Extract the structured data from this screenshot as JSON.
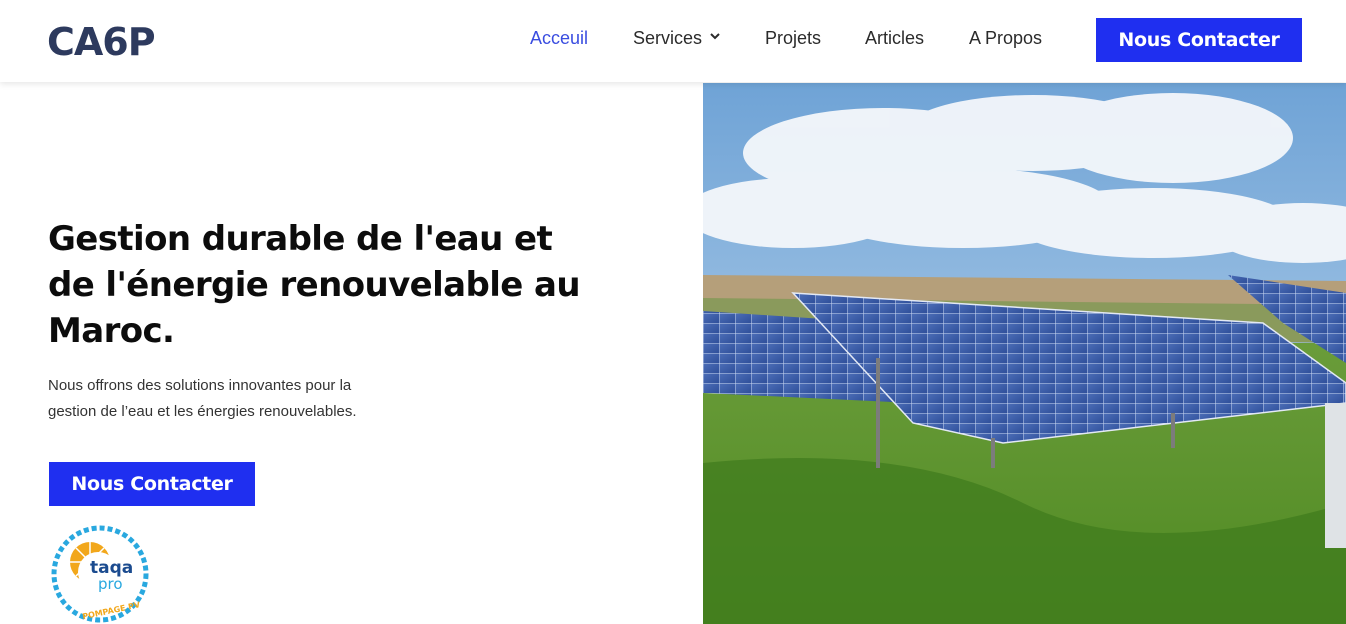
{
  "header": {
    "logo_text": "CA6P",
    "nav": [
      {
        "label": "Acceuil"
      },
      {
        "label": "Services"
      },
      {
        "label": "Projets"
      },
      {
        "label": "Articles"
      },
      {
        "label": "A Propos"
      }
    ],
    "cta_label": "Nous Contacter"
  },
  "hero": {
    "title_line1": "Gestion durable de l'eau et",
    "title_line2": "de l'énergie renouvelable au",
    "title_line3": "Maroc.",
    "subtitle_line1": "Nous offrons des solutions innovantes pour la",
    "subtitle_line2": "gestion de l’eau et les énergies renouvelables.",
    "cta_label": "Nous Contacter",
    "badge": {
      "brand_line1": "taqa",
      "brand_line2": "pro",
      "caption": "POMPAGE PV"
    }
  },
  "colors": {
    "accent": "#1f2ff0",
    "nav_active": "#3a4de0",
    "logo": "#2d3a5e"
  },
  "icons": {
    "services_dropdown": "chevron-down-icon"
  }
}
